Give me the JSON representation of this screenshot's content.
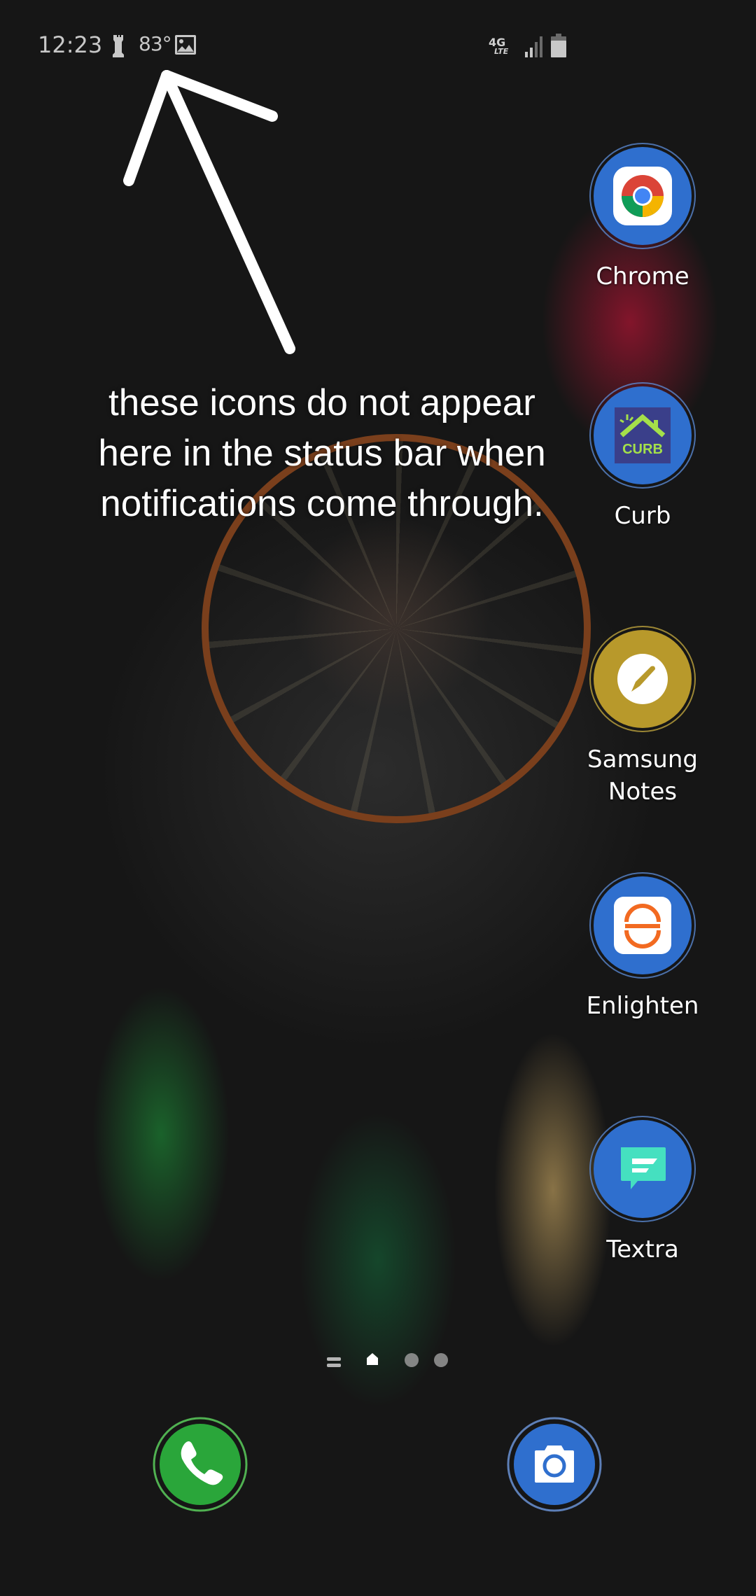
{
  "status_bar": {
    "time": "12:23",
    "weather_icon": "weather-icon",
    "temperature": "83°",
    "notification_icon": "gallery-icon",
    "network_type_top": "4G",
    "network_type_bottom": "LTE",
    "signal_icon": "signal-icon",
    "battery_icon": "battery-icon"
  },
  "annotation": {
    "line1": "these icons do not appear",
    "line2": "here in the status bar when",
    "line3": "notifications come through.",
    "arrow": "arrow-up-left-icon"
  },
  "home_apps": [
    {
      "label": "Chrome",
      "icon": "chrome-icon",
      "bg": "#2f6fce"
    },
    {
      "label": "Curb",
      "icon": "curb-icon",
      "bg": "#2f6fce"
    },
    {
      "label": "Samsung\nNotes",
      "label_line1": "Samsung",
      "label_line2": "Notes",
      "icon": "samsung-notes-icon",
      "bg": "#b8992b"
    },
    {
      "label": "Enlighten",
      "icon": "enlighten-icon",
      "bg": "#2f6fce"
    },
    {
      "label": "Textra",
      "icon": "textra-icon",
      "bg": "#2f6fce"
    }
  ],
  "page_indicator": {
    "items": [
      "menu-handle-icon",
      "home-page-icon",
      "page-dot",
      "page-dot"
    ],
    "current": 1
  },
  "dock": [
    {
      "name": "Phone",
      "icon": "phone-icon",
      "bg": "#2aa63a"
    },
    {
      "name": "Camera",
      "icon": "camera-icon",
      "bg": "#2f6fce"
    }
  ],
  "colors": {
    "status_text": "#c8c8c8",
    "annotation_text": "#ffffff",
    "chrome_red": "#db4437",
    "chrome_yellow": "#f4b400",
    "chrome_green": "#0f9d58",
    "chrome_blue": "#4285f4",
    "curb_green": "#a4e04a",
    "enlighten_orange": "#f26a21",
    "textra_teal": "#45e0c0"
  }
}
